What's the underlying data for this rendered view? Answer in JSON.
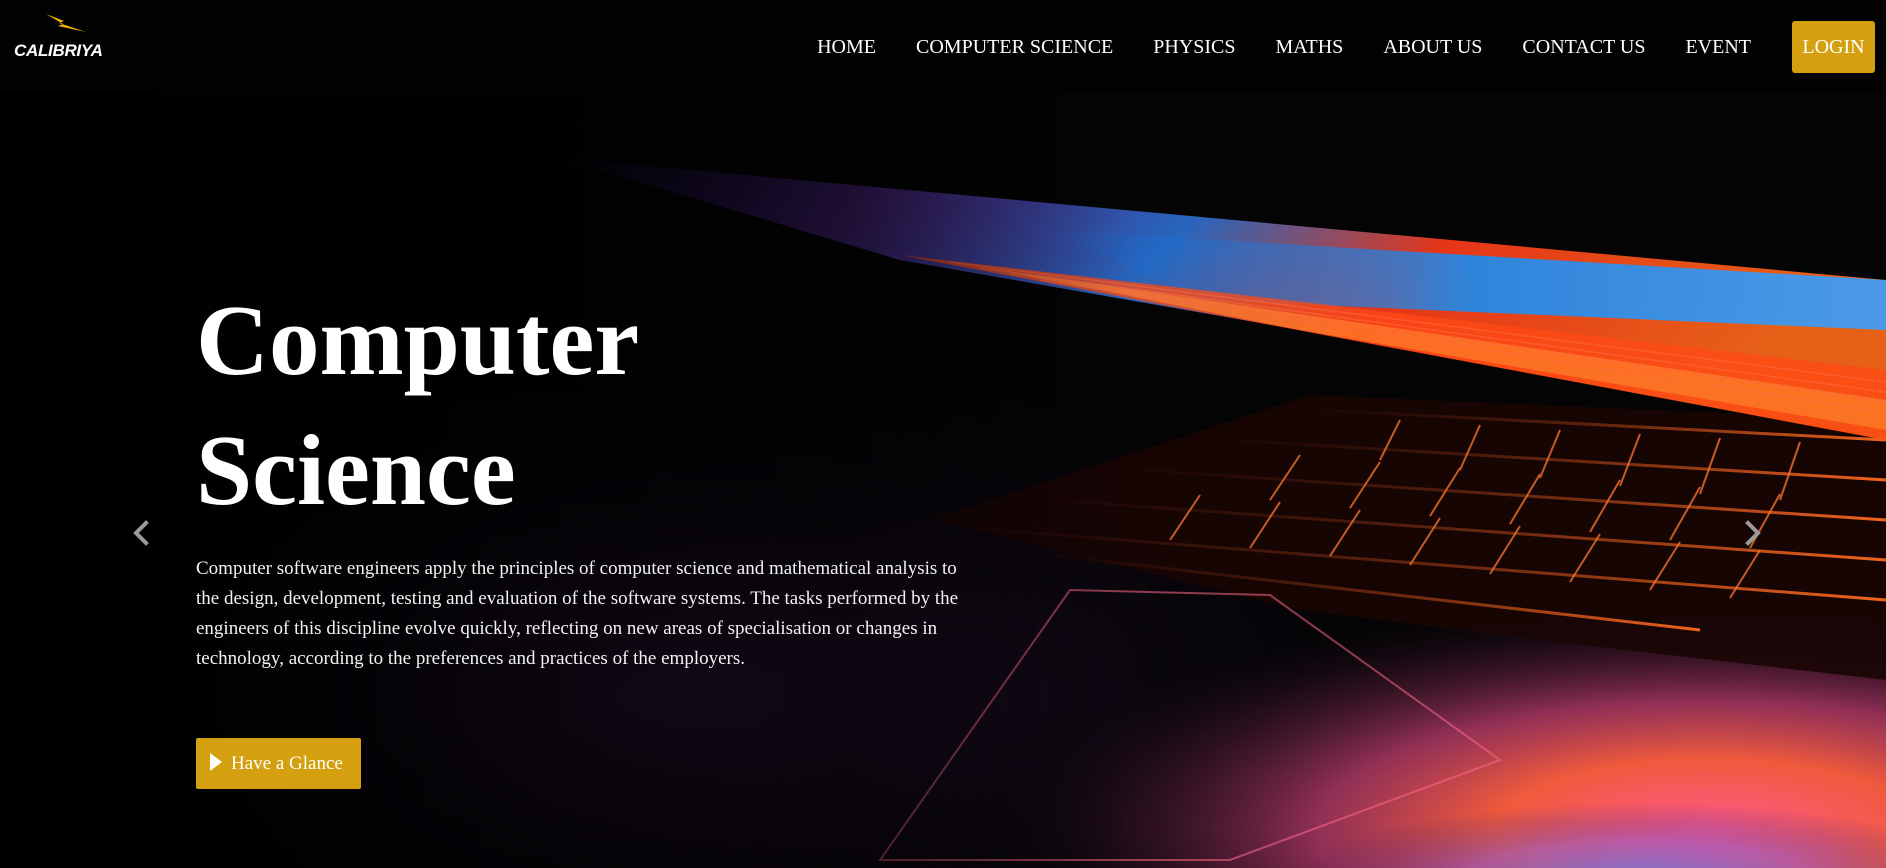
{
  "brand": {
    "name": "CALIBRIYA",
    "accent": "#d4a00f"
  },
  "nav": {
    "items": [
      {
        "label": "HOME"
      },
      {
        "label": "COMPUTER SCIENCE"
      },
      {
        "label": "PHYSICS"
      },
      {
        "label": "MATHS"
      },
      {
        "label": "ABOUT US"
      },
      {
        "label": "CONTACT US"
      },
      {
        "label": "EVENT"
      }
    ],
    "login_label": "LOGIN"
  },
  "hero": {
    "title_line1": "Computer",
    "title_line2": "Science",
    "description": "Computer software engineers apply the principles of computer science and mathematical analysis to the design, development, testing and evaluation of the software systems. The tasks performed by the engineers of this discipline evolve quickly, reflecting on new areas of specialisation or changes in technology, according to the preferences and practices of the employers.",
    "cta_label": "Have a Glance",
    "cta_icon": "play-icon",
    "prev_icon": "chevron-left-icon",
    "next_icon": "chevron-right-icon",
    "background": "laptop-keyboard-neon-photo"
  },
  "colors": {
    "accent": "#d4a00f",
    "nav_bg": "#020202",
    "text": "#ffffff"
  }
}
